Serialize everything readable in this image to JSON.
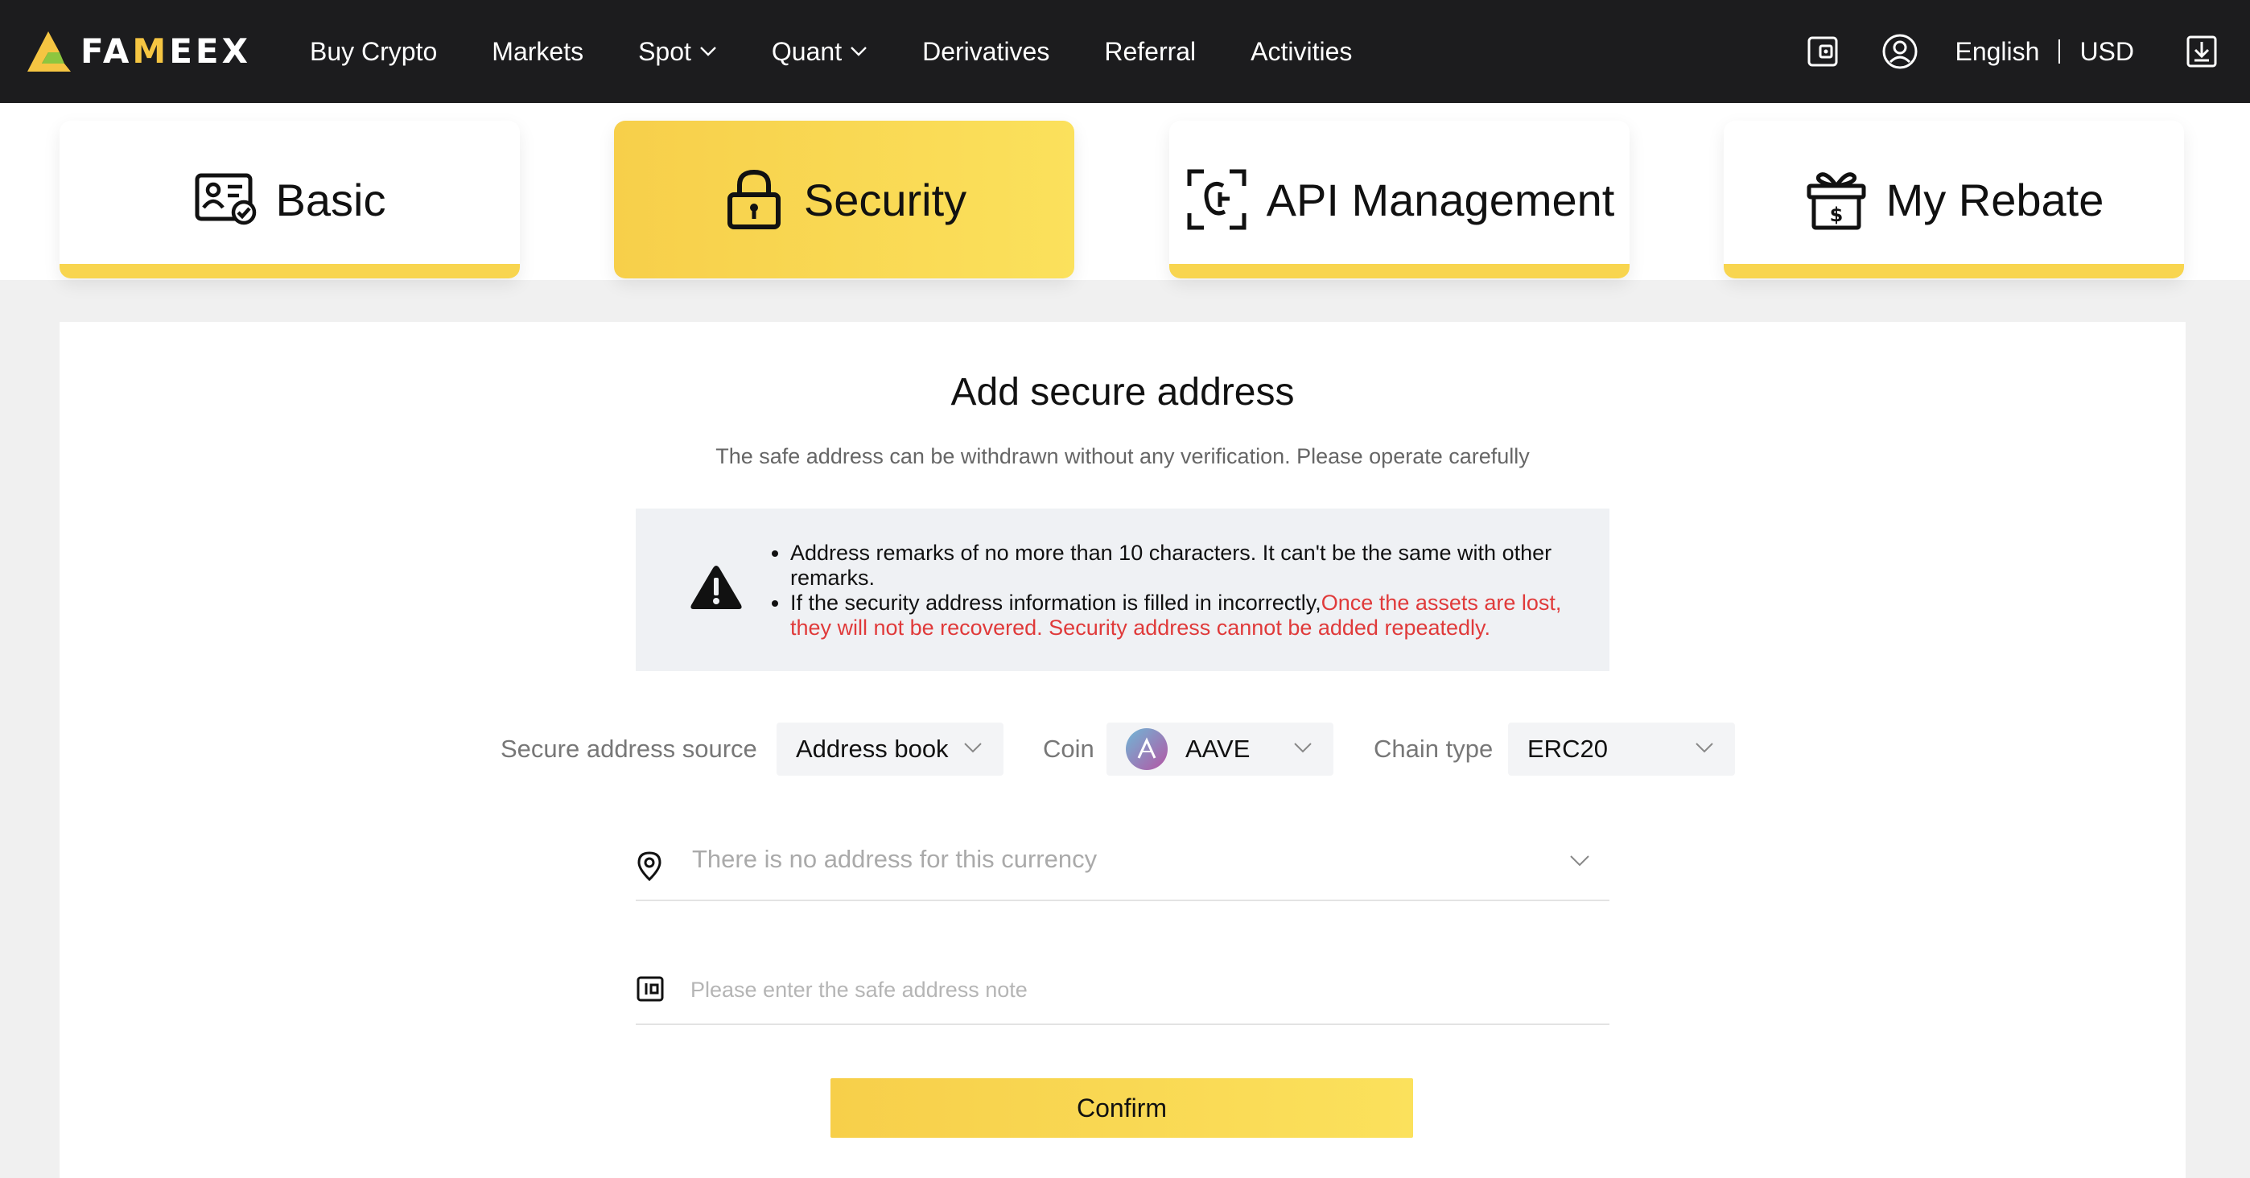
{
  "brand": {
    "name_prefix": "FA",
    "name_accent": "M",
    "name_suffix": "EEX",
    "accent_color": "#f5c542"
  },
  "nav": {
    "items": [
      {
        "label": "Buy Crypto",
        "has_dropdown": false
      },
      {
        "label": "Markets",
        "has_dropdown": false
      },
      {
        "label": "Spot",
        "has_dropdown": true
      },
      {
        "label": "Quant",
        "has_dropdown": true
      },
      {
        "label": "Derivatives",
        "has_dropdown": false
      },
      {
        "label": "Referral",
        "has_dropdown": false
      },
      {
        "label": "Activities",
        "has_dropdown": false
      }
    ],
    "language": "English",
    "currency": "USD",
    "icons": [
      "wallet-icon",
      "user-icon",
      "download-icon"
    ]
  },
  "tabs": [
    {
      "label": "Basic",
      "icon": "id-card-icon",
      "active": false
    },
    {
      "label": "Security",
      "icon": "lock-icon",
      "active": true
    },
    {
      "label": "API Management",
      "icon": "api-icon",
      "active": false
    },
    {
      "label": "My Rebate",
      "icon": "gift-icon",
      "active": false
    }
  ],
  "form": {
    "title": "Add secure address",
    "subtitle": "The safe address can be withdrawn without any verification. Please operate carefully",
    "notice": {
      "item1": "Address remarks of no more than 10 characters. It can't be the same with other remarks.",
      "item2_black": "If the security address information is filled in incorrectly,",
      "item2_red": "Once the assets are lost, they will not be recovered. Security address cannot be added repeatedly."
    },
    "source_label": "Secure address source",
    "source_value": "Address book",
    "coin_label": "Coin",
    "coin_value": "AAVE",
    "chain_label": "Chain type",
    "chain_value": "ERC20",
    "address_placeholder": "There is no address for this currency",
    "note_placeholder": "Please enter the safe address note",
    "confirm_label": "Confirm"
  }
}
